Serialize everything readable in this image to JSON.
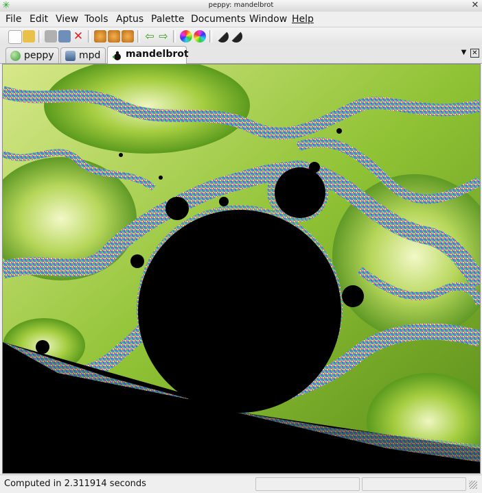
{
  "window": {
    "title": "peppy: mandelbrot"
  },
  "menu": [
    "File",
    "Edit",
    "View",
    "Tools",
    "Aptus",
    "Palette",
    "Documents",
    "Window",
    "Help"
  ],
  "tabs": [
    {
      "label": "peppy",
      "icon": "globe-icon"
    },
    {
      "label": "mpd",
      "icon": "media-player-icon"
    },
    {
      "label": "mandelbrot",
      "icon": "fractal-icon",
      "active": true
    }
  ],
  "status": {
    "text": "Computed in 2.311914 seconds"
  },
  "colors": {
    "accent_green": "#9bcf2a",
    "deep_green": "#3a7f10",
    "teal": "#36d0b0",
    "fractal_black": "#000000"
  }
}
